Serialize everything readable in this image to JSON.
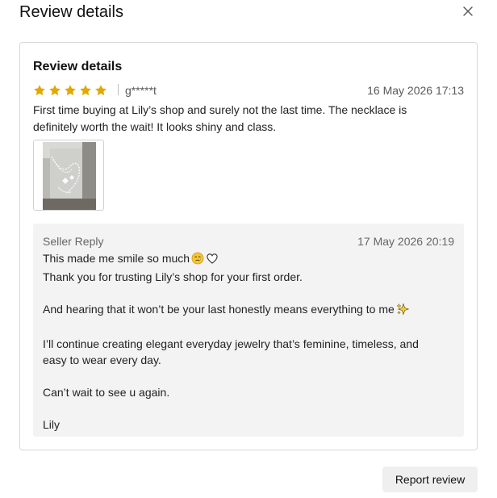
{
  "modal": {
    "title": "Review details",
    "close_icon": "close-icon"
  },
  "review": {
    "heading": "Review details",
    "rating": 5,
    "rating_max": 5,
    "star_color": "#e0a800",
    "reviewer": "g*****t",
    "date": "16 May 2026 17:13",
    "text": "First time buying at Lily’s shop and surely not the last time. The necklace is definitely worth the wait! It looks shiny and class.",
    "photo_icon": "necklace-photo"
  },
  "reply": {
    "label": "Seller Reply",
    "date": "17 May 2026 20:19",
    "lines": [
      "This made me smile so much",
      "Thank you for trusting Lily’s shop for your first order.",
      "And hearing that it won’t be your last honestly means everything to me",
      "I’ll continue creating elegant everyday jewelry that’s feminine, timeless, and",
      "easy to wear every day.",
      "Can’t wait to see u again.",
      "Lily"
    ],
    "emoji_icons": [
      "smiling-face-with-tear-icon",
      "white-heart-icon",
      "sparkles-icon"
    ]
  },
  "actions": {
    "report_label": "Report review"
  }
}
